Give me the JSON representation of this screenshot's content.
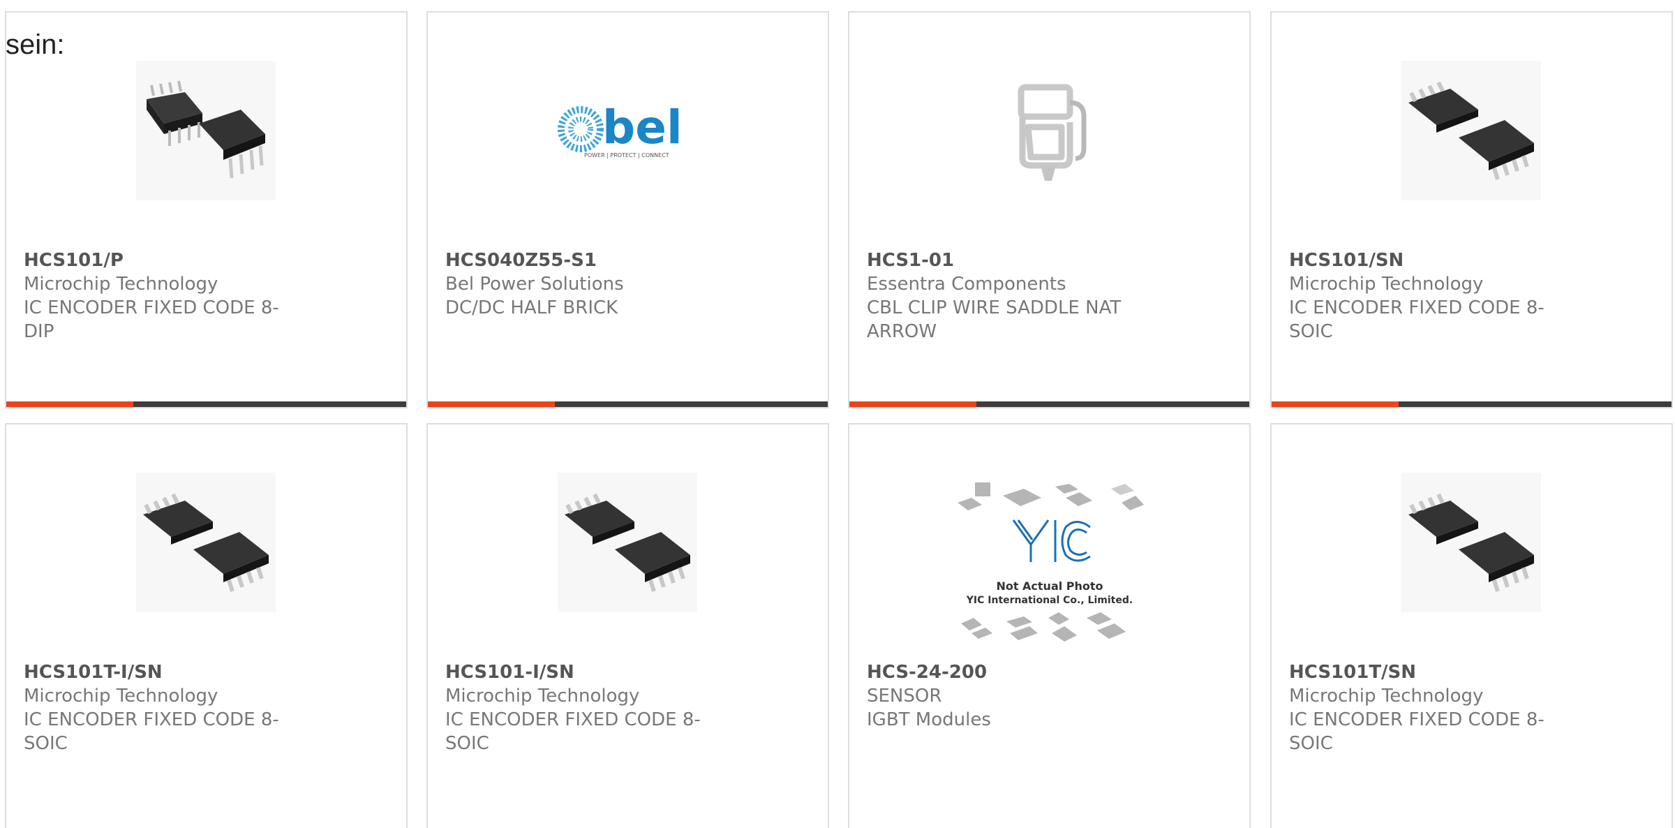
{
  "intro_text": "sein:",
  "products": [
    {
      "part": "HCS101/P",
      "manufacturer": "Microchip Technology",
      "description": "IC ENCODER FIXED CODE 8-DIP",
      "image": "dip-chip-image"
    },
    {
      "part": "HCS040Z55-S1",
      "manufacturer": "Bel Power Solutions",
      "description": "DC/DC HALF BRICK",
      "image": "bel-logo-image",
      "logo_text": "bel",
      "logo_tagline": "POWER | PROTECT | CONNECT"
    },
    {
      "part": "HCS1-01",
      "manufacturer": "Essentra Components",
      "description": "CBL CLIP WIRE SADDLE NAT ARROW",
      "image": "cable-clip-image"
    },
    {
      "part": "HCS101/SN",
      "manufacturer": "Microchip Technology",
      "description": "IC ENCODER FIXED CODE 8-SOIC",
      "image": "soic-chip-image"
    },
    {
      "part": "HCS101T-I/SN",
      "manufacturer": "Microchip Technology",
      "description": "IC ENCODER FIXED CODE 8-SOIC",
      "image": "soic-chip-image"
    },
    {
      "part": "HCS101-I/SN",
      "manufacturer": "Microchip Technology",
      "description": "IC ENCODER FIXED CODE 8-SOIC",
      "image": "soic-chip-image"
    },
    {
      "part": "HCS-24-200",
      "manufacturer": "SENSOR",
      "description": "IGBT Modules",
      "image": "not-actual-photo-image",
      "placeholder_line1": "Not Actual Photo",
      "placeholder_line2": "YIC International Co., Limited."
    },
    {
      "part": "HCS101T/SN",
      "manufacturer": "Microchip Technology",
      "description": "IC ENCODER FIXED CODE 8-SOIC",
      "image": "soic-chip-image"
    }
  ],
  "colors": {
    "accent": "#e8441d",
    "bar": "#3d3d3d",
    "border": "#dddddd",
    "part_text": "#555555",
    "body_text": "#777777"
  }
}
